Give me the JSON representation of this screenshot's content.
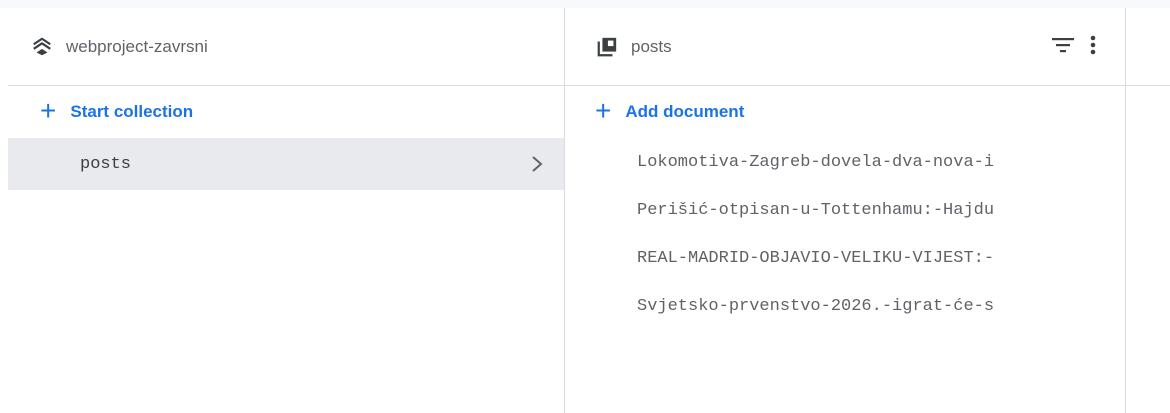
{
  "root_panel": {
    "title": "webproject-zavrsni",
    "icon": "project-layers-icon",
    "start_collection_label": "Start collection",
    "collections": [
      {
        "label": "posts",
        "selected": true
      }
    ]
  },
  "collection_panel": {
    "title": "posts",
    "icon": "collection-icon",
    "add_document_label": "Add document",
    "documents": [
      "Lokomotiva-Zagreb-dovela-dva-nova-i",
      "Perišić-otpisan-u-Tottenhamu:-Hajdu",
      "REAL-MADRID-OBJAVIO-VELIKU-VIJEST:-",
      "Svjetsko-prvenstvo-2026.-igrat-će-s"
    ]
  },
  "colors": {
    "accent": "#1a73e8",
    "selected_bg": "#e8eaed",
    "border": "#dadce0",
    "text_muted": "#5f6368"
  }
}
